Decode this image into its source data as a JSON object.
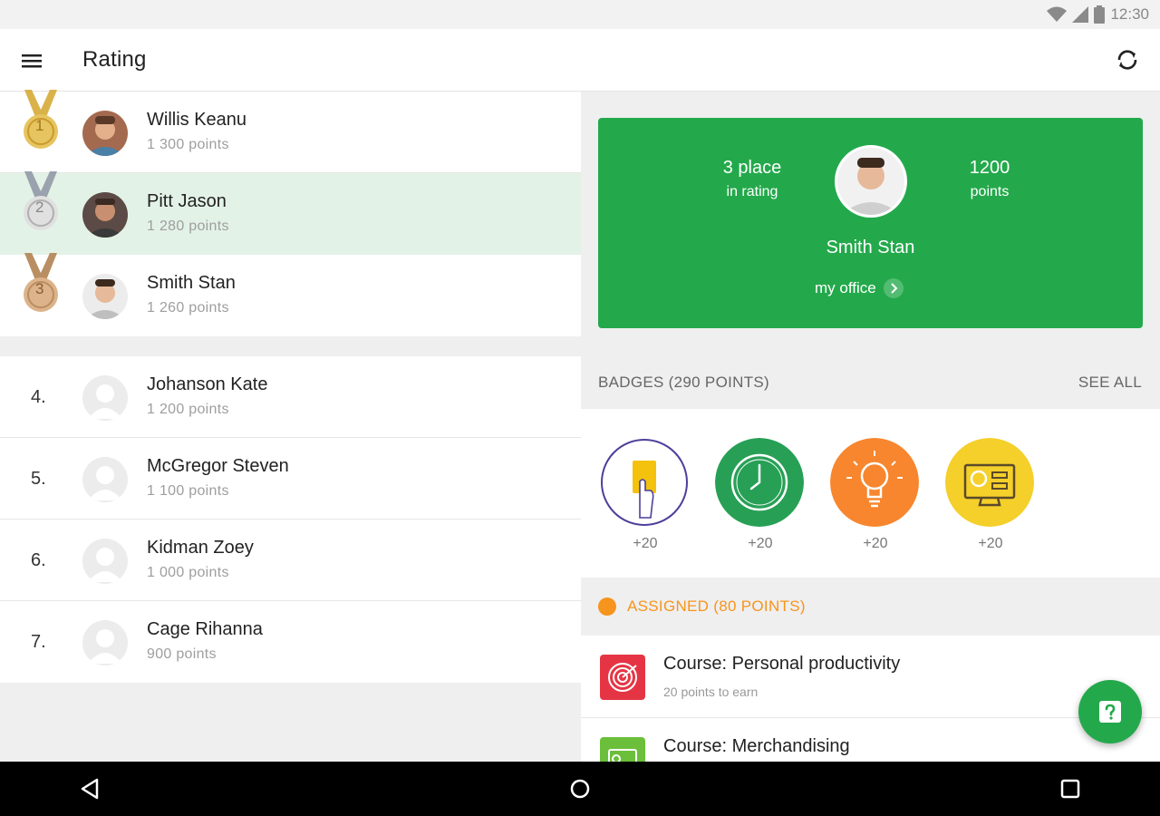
{
  "status": {
    "time": "12:30",
    "icons": [
      "wifi-icon",
      "signal-icon",
      "battery-icon"
    ]
  },
  "appbar": {
    "title": "Rating",
    "menu_icon": "hamburger-icon",
    "action_icon": "sync-icon"
  },
  "leaders": [
    {
      "rank": "1",
      "name": "Willis Keanu",
      "points": "1 300 points",
      "medal": "gold"
    },
    {
      "rank": "2",
      "name": "Pitt Jason",
      "points": "1 280 points",
      "medal": "silver",
      "selected": true
    },
    {
      "rank": "3",
      "name": "Smith Stan",
      "points": "1 260 points",
      "medal": "bronze"
    }
  ],
  "others": [
    {
      "rank": "4.",
      "name": "Johanson Kate",
      "points": "1 200 points"
    },
    {
      "rank": "5.",
      "name": "McGregor Steven",
      "points": "1 100 points"
    },
    {
      "rank": "6.",
      "name": "Kidman Zoey",
      "points": "1 000 points"
    },
    {
      "rank": "7.",
      "name": "Cage Rihanna",
      "points": "900 points"
    }
  ],
  "profile_card": {
    "place_big": "3 place",
    "place_small": "in rating",
    "points_big": "1200",
    "points_small": "points",
    "name": "Smith Stan",
    "link": "my office"
  },
  "badges": {
    "heading": "BADGES (290 POINTS)",
    "see_all": "SEE ALL",
    "items": [
      {
        "icon": "yellow-card-icon",
        "bonus": "+20"
      },
      {
        "icon": "clock-icon",
        "bonus": "+20"
      },
      {
        "icon": "lightbulb-icon",
        "bonus": "+20"
      },
      {
        "icon": "gear-monitor-icon",
        "bonus": "+20"
      }
    ]
  },
  "assigned": {
    "heading": "ASSIGNED (80 POINTS)",
    "courses": [
      {
        "title": "Course: Personal productivity",
        "sub": "20 points to earn",
        "icon": "target-icon"
      },
      {
        "title": "Course: Merchandising",
        "sub": "",
        "icon": "register-icon"
      }
    ]
  },
  "colors": {
    "accent": "#23a94b",
    "assigned": "#f7941d",
    "selected_row": "#e3f2e7"
  }
}
